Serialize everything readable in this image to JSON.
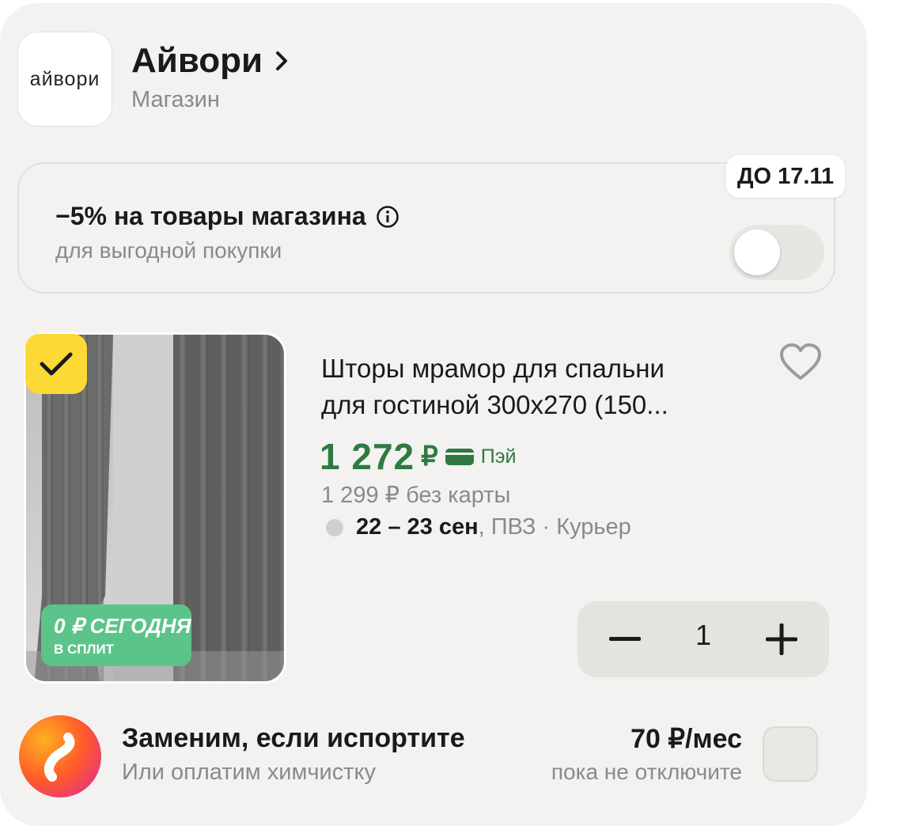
{
  "store": {
    "logo_text": "айвори",
    "name": "Айвори",
    "type": "Магазин"
  },
  "promo": {
    "title": "−5% на товары магазина",
    "subtitle": "для выгодной покупки",
    "until": "ДО 17.11",
    "toggle_on": false
  },
  "product": {
    "title_line1": "Шторы мрамор для спальни",
    "title_line2": "для гостиной 300х270 (150...",
    "selected": true,
    "split_badge_main": "0 ₽ СЕГОДНЯ",
    "split_badge_sub": "В СПЛИТ",
    "price": "1 272",
    "price_currency": "₽",
    "pay_label": "Пэй",
    "price_without_card": "1 299 ₽  без карты",
    "delivery_date": "22 – 23 сен",
    "delivery_method": ", ПВЗ · Курьер",
    "quantity": "1",
    "favorite": false
  },
  "insurance": {
    "title": "Заменим, если испортите",
    "subtitle": "Или оплатим химчистку",
    "price": "70 ₽/мес",
    "note": "пока не отключите",
    "checked": false
  },
  "colors": {
    "price_green": "#2f7a42",
    "check_yellow": "#fdd936",
    "split_green": "#5cc48a"
  }
}
